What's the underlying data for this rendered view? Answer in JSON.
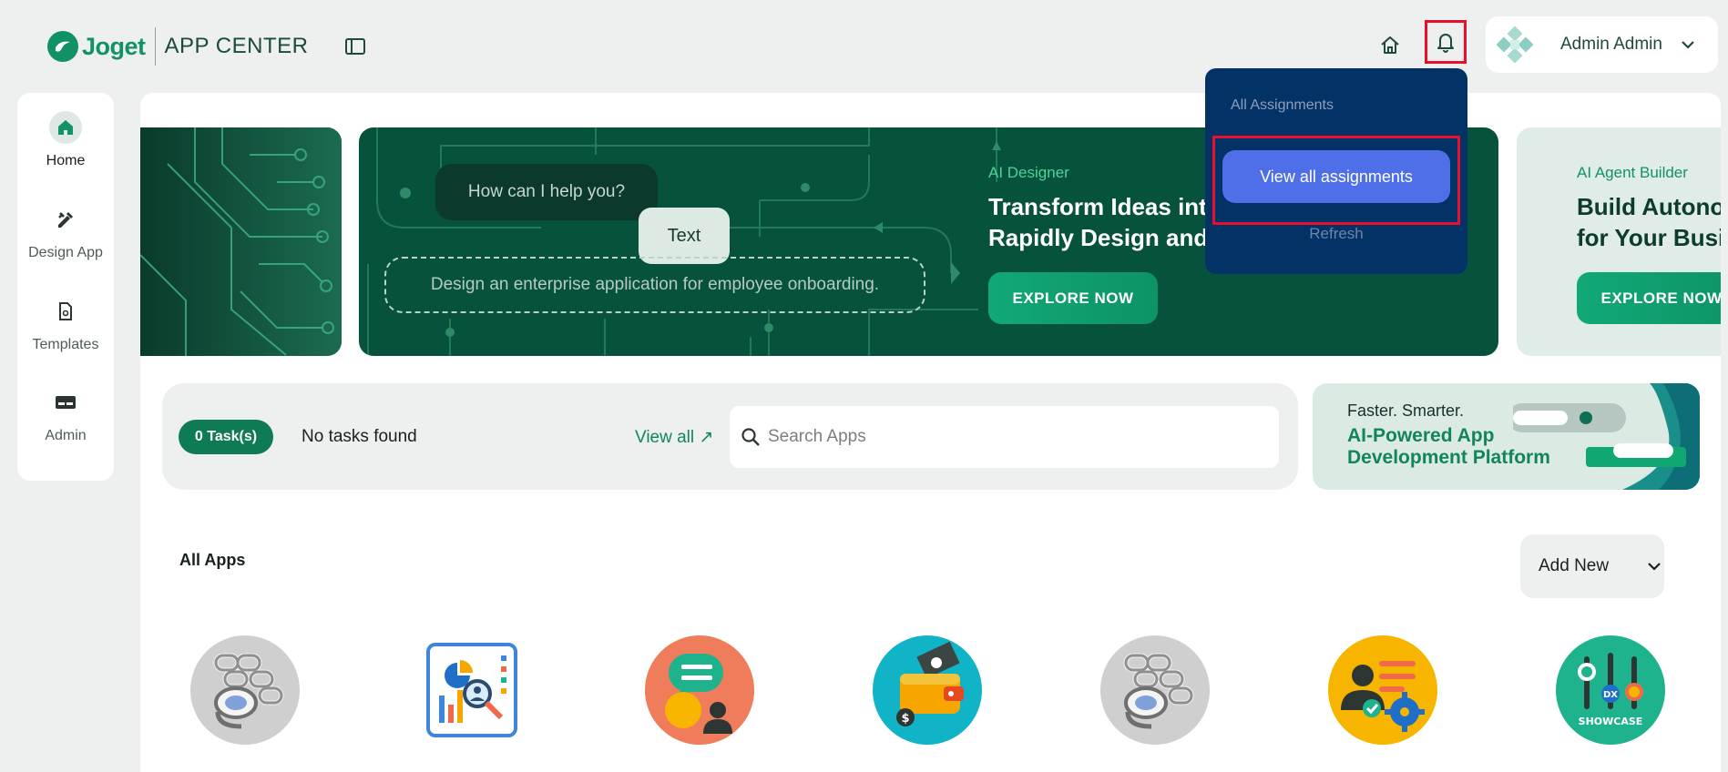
{
  "header": {
    "logo_text": "Joget",
    "app_center": "APP CENTER",
    "user_name": "Admin Admin"
  },
  "leftnav": {
    "items": [
      {
        "label": "Home",
        "icon": "home-icon",
        "active": true
      },
      {
        "label": "Design App",
        "icon": "design-tools-icon",
        "active": false
      },
      {
        "label": "Templates",
        "icon": "template-icon",
        "active": false
      },
      {
        "label": "Admin",
        "icon": "admin-card-icon",
        "active": false
      }
    ]
  },
  "banners": {
    "main": {
      "bubble_help": "How can I help you?",
      "bubble_text": "Text",
      "prompt": "Design an enterprise application for employee onboarding.",
      "tag": "AI Designer",
      "title_line1": "Transform Ideas int",
      "title_line2": "Rapidly Design and",
      "cta": "EXPLORE NOW"
    },
    "right": {
      "tag": "AI Agent Builder",
      "title_line1": "Build Autono",
      "title_line2": "for Your Busi",
      "cta": "EXPLORE NOW"
    }
  },
  "tasks": {
    "badge": "0 Task(s)",
    "empty_text": "No tasks found",
    "view_all": "View all ↗",
    "search_placeholder": "Search Apps"
  },
  "promo": {
    "line1": "Faster. Smarter.",
    "line2": "AI-Powered App",
    "line3": "Development Platform"
  },
  "apps": {
    "heading": "All Apps",
    "add_new": "Add New",
    "items": [
      {
        "icon": "app-chain-icon",
        "bg": "#c9c9c9"
      },
      {
        "icon": "app-analytics-icon",
        "bg": "#ffffff"
      },
      {
        "icon": "app-chat-icon",
        "bg": "#ef7c5a"
      },
      {
        "icon": "app-wallet-icon",
        "bg": "#11b3c6"
      },
      {
        "icon": "app-chain-icon",
        "bg": "#c9c9c9"
      },
      {
        "icon": "app-hr-settings-icon",
        "bg": "#f7b500"
      },
      {
        "icon": "app-dx-showcase-icon",
        "bg": "#1fb38d",
        "caption": "SHOWCASE",
        "badge": "DX"
      }
    ]
  },
  "dropdown": {
    "heading": "All Assignments",
    "view_all_button": "View all assignments",
    "refresh": "Refresh"
  },
  "colors": {
    "brand": "#129166",
    "banner_dark": "#07523c",
    "dropdown_bg": "#023266",
    "dropdown_button": "#4e6fe7",
    "highlight": "#e8102a"
  }
}
